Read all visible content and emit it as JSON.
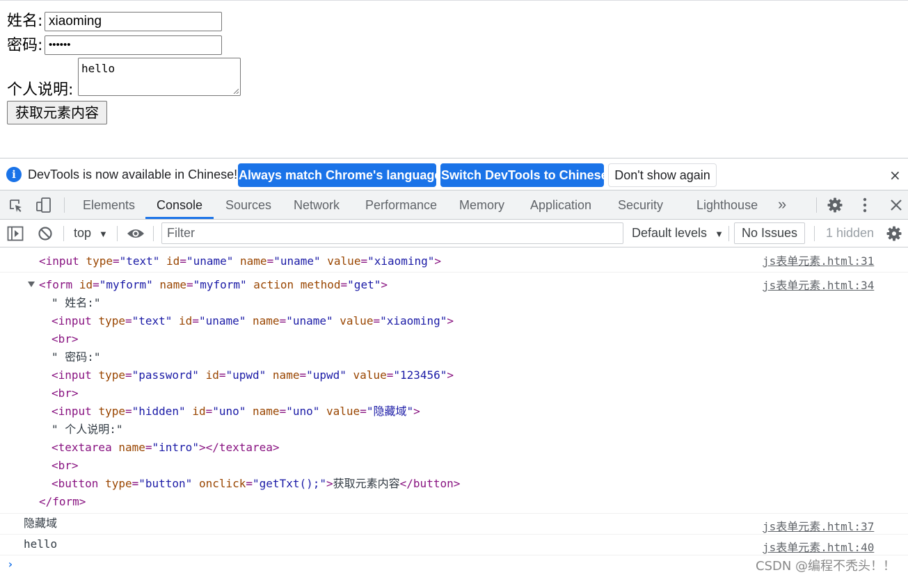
{
  "page": {
    "name_label": "姓名:",
    "name_value": "xiaoming",
    "pwd_label": "密码:",
    "pwd_value": "••••••",
    "intro_label": "个人说明:",
    "intro_value": "hello",
    "button_label": "获取元素内容"
  },
  "infobar": {
    "message": "DevTools is now available in Chinese!",
    "btn_match": "Always match Chrome's language",
    "btn_switch": "Switch DevTools to Chinese",
    "btn_dont": "Don't show again",
    "close": "×"
  },
  "tabs": {
    "elements": "Elements",
    "console": "Console",
    "sources": "Sources",
    "network": "Network",
    "performance": "Performance",
    "memory": "Memory",
    "application": "Application",
    "security": "Security",
    "lighthouse": "Lighthouse",
    "more": "»"
  },
  "toolbar": {
    "context": "top",
    "filter_placeholder": "Filter",
    "levels": "Default levels",
    "issues": "No Issues",
    "hidden": "1 hidden"
  },
  "console": {
    "msg1": {
      "source": "js表单元素.html:31",
      "t_open": "<input",
      "a_type": "type",
      "v_type": "\"text\"",
      "a_id": "id",
      "v_id": "\"uname\"",
      "a_name": "name",
      "v_name": "\"uname\"",
      "a_value": "value",
      "v_value": "\"xiaoming\"",
      "t_close": ">"
    },
    "msg2": {
      "source": "js表单元素.html:34",
      "l1_open": "<form",
      "l1_a1": "id",
      "l1_v1": "\"myform\"",
      "l1_a2": "name",
      "l1_v2": "\"myform\"",
      "l1_a3": "action",
      "l1_a4": "method",
      "l1_v4": "\"get\"",
      "l1_close": ">",
      "l2_text": "\" 姓名:\"",
      "l3_open": "<input",
      "l3_a1": "type",
      "l3_v1": "\"text\"",
      "l3_a2": "id",
      "l3_v2": "\"uname\"",
      "l3_a3": "name",
      "l3_v3": "\"uname\"",
      "l3_a4": "value",
      "l3_v4": "\"xiaoming\"",
      "l3_close": ">",
      "l4": "<br>",
      "l5_text": "\" 密码:\"",
      "l6_open": "<input",
      "l6_a1": "type",
      "l6_v1": "\"password\"",
      "l6_a2": "id",
      "l6_v2": "\"upwd\"",
      "l6_a3": "name",
      "l6_v3": "\"upwd\"",
      "l6_a4": "value",
      "l6_v4": "\"123456\"",
      "l6_close": ">",
      "l7": "<br>",
      "l8_open": "<input",
      "l8_a1": "type",
      "l8_v1": "\"hidden\"",
      "l8_a2": "id",
      "l8_v2": "\"uno\"",
      "l8_a3": "name",
      "l8_v3": "\"uno\"",
      "l8_a4": "value",
      "l8_v4": "\"隐藏域\"",
      "l8_close": ">",
      "l9_text": "\" 个人说明:\"",
      "l10_open": "<textarea",
      "l10_a1": "name",
      "l10_v1": "\"intro\"",
      "l10_close": "></textarea>",
      "l11": "<br>",
      "l12_open": "<button",
      "l12_a1": "type",
      "l12_v1": "\"button\"",
      "l12_a2": "onclick",
      "l12_v2": "\"getTxt();\"",
      "l12_gt": ">",
      "l12_text": "获取元素内容",
      "l12_close": "</button>",
      "l13": "</form>"
    },
    "msg3": {
      "text": "隐藏域",
      "source": "js表单元素.html:37"
    },
    "msg4": {
      "text": "hello",
      "source": "js表单元素.html:40"
    },
    "prompt": "›"
  },
  "watermark": "CSDN @编程不秃头！！"
}
